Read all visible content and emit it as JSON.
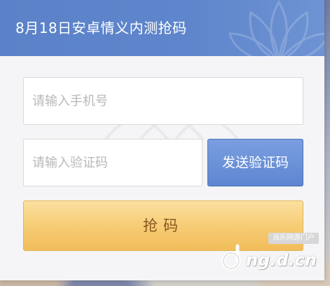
{
  "dialog": {
    "title": "8月18日安卓情义内测抢码"
  },
  "form": {
    "phone_placeholder": "请输入手机号",
    "phone_value": "",
    "code_placeholder": "请输入验证码",
    "code_value": "",
    "send_code_label": "发送验证码",
    "grab_label": "抢码"
  },
  "watermark": {
    "tag": "当乐网游门户",
    "domain": "ng.d.cn",
    "logo_icon": "d-logo-icon"
  },
  "colors": {
    "header": "#5b82c8",
    "send_button": "#6a90d6",
    "grab_button": "#f6cb72",
    "grab_text": "#8a5520"
  }
}
